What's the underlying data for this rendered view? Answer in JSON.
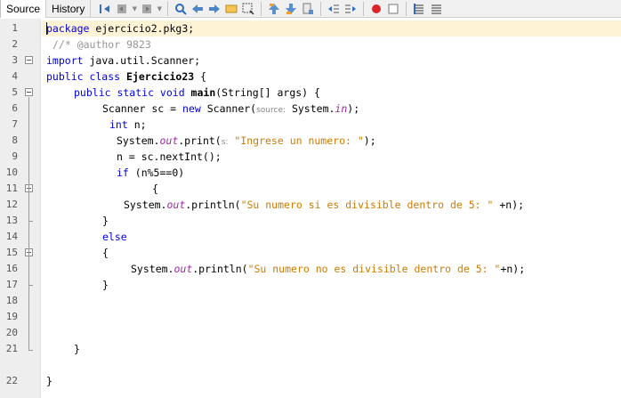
{
  "tabs": [
    {
      "label": "Source",
      "active": true
    },
    {
      "label": "History",
      "active": false
    }
  ],
  "toolbar_icons": [
    "last-edit-icon",
    "back-icon",
    "forward-icon",
    "find-icon",
    "find-previous-icon",
    "find-next-icon",
    "toggle-highlight-icon",
    "toggle-rect-select-icon",
    "previous-bookmark-icon",
    "next-bookmark-icon",
    "toggle-bookmark-icon",
    "shift-left-icon",
    "shift-right-icon",
    "record-macro-icon",
    "stop-macro-icon",
    "comment-icon",
    "uncomment-icon"
  ],
  "line_numbers": [
    "1",
    "2",
    "3",
    "4",
    "5",
    "6",
    "7",
    "8",
    "9",
    "10",
    "11",
    "12",
    "13",
    "14",
    "15",
    "16",
    "17",
    "18",
    "19",
    "20",
    "21",
    "22"
  ],
  "code": {
    "l1": {
      "kw": "package",
      "rest": " ejercicio2.pkg3;"
    },
    "l2": {
      "comment": "//* @author 9823"
    },
    "l3": {
      "kw": "import",
      "rest": " java.util.Scanner;"
    },
    "l4": {
      "kw": "public class",
      "name": " Ejercicio23",
      "rest": " {"
    },
    "l5": {
      "kw": "public static void",
      "name": " main",
      "rest": "(String[] args) {"
    },
    "l6": {
      "a": "Scanner sc = ",
      "kw": "new",
      "b": " Scanner(",
      "hint": "source:",
      "c": " System.",
      "field": "in",
      "d": ");"
    },
    "l7": {
      "kw": "int",
      "rest": " n;"
    },
    "l8": {
      "a": "System.",
      "field": "out",
      "b": ".print(",
      "hint": "s:",
      "str": " \"Ingrese un numero: \"",
      "c": ");"
    },
    "l9": {
      "text": "n = sc.nextInt();"
    },
    "l10": {
      "kw": "if",
      "rest": " (n%5==0)"
    },
    "l11": {
      "text": "{"
    },
    "l12": {
      "a": "System.",
      "field": "out",
      "b": ".println(",
      "str": "\"Su numero si es divisible dentro de 5: \"",
      "c": " +n);"
    },
    "l13": {
      "text": "}"
    },
    "l14": {
      "kw": "else"
    },
    "l15": {
      "text": "{"
    },
    "l16": {
      "a": "System.",
      "field": "out",
      "b": ".println(",
      "str": "\"Su numero no es divisible dentro de 5: \"",
      "c": "+n);"
    },
    "l17": {
      "text": "}"
    },
    "l21": {
      "text": "}"
    },
    "l22": {
      "text": "}"
    }
  }
}
